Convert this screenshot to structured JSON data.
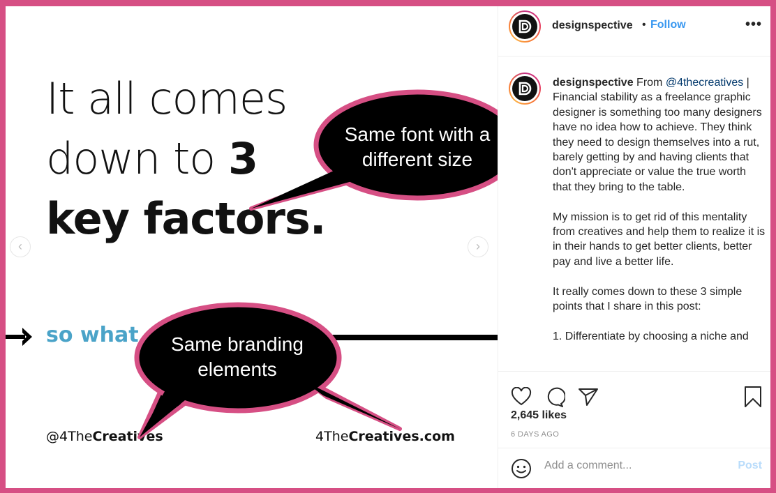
{
  "slide": {
    "headline_line1": "It all comes",
    "headline_line2_normal": "down to ",
    "headline_line2_bold": "3",
    "headline_line3_bold": "key factors.",
    "subline": "so what c",
    "handle_left_normal": "@4The",
    "handle_left_bold": "Creatives",
    "handle_right_normal": "4The",
    "handle_right_bold": "Creatives.com",
    "prev_glyph": "‹",
    "next_glyph": "›",
    "accent_color": "#4aa3c8"
  },
  "annotations": {
    "bubble1": "Same font with a different size",
    "bubble2": "Same branding elements",
    "bubble_fill": "#000000",
    "bubble_stroke": "#d64f84"
  },
  "post": {
    "username": "designspective",
    "separator": "•",
    "follow_label": "Follow",
    "more_label": "•••",
    "avatar_letter": "D",
    "caption": {
      "username": "designspective",
      "lead": " From ",
      "mention": "@4thecreatives",
      "p1_rest": " | Financial stability as a freelance graphic designer is something too many designers have no idea how to achieve. They think they need to design themselves into a rut, barely getting by and having clients that don't appreciate or value the true worth that they bring to the table.",
      "p2": "My mission is to get rid of this mentality from creatives and help them to realize it is in their hands to get better clients, better pay and live a better life.",
      "p3": "It really comes down to these 3 simple points that I share in this post:",
      "p4": "1. Differentiate by choosing a niche and"
    },
    "likes": "2,645 likes",
    "timestamp": "6 DAYS AGO",
    "comment_placeholder": "Add a comment...",
    "post_label": "Post",
    "link_color": "#3897f0"
  }
}
